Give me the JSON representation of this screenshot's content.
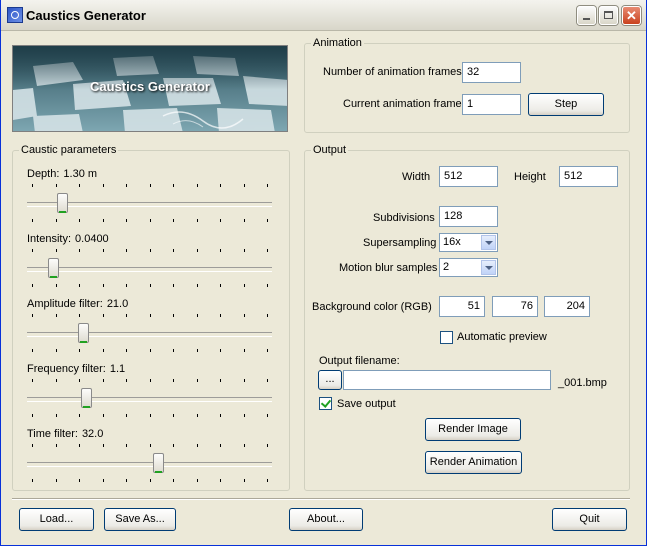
{
  "window": {
    "title": "Caustics Generator"
  },
  "banner": {
    "text": "Caustics Generator"
  },
  "animation": {
    "legend": "Animation",
    "frames_label": "Number of animation frames",
    "frames_value": "32",
    "current_label": "Current animation frame",
    "current_value": "1",
    "step_label": "Step"
  },
  "caustic": {
    "legend": "Caustic parameters",
    "sliders": [
      {
        "label": "Depth:",
        "value": "1.30 m",
        "level": 0.13
      },
      {
        "label": "Intensity:",
        "value": "0.0400",
        "level": 0.09
      },
      {
        "label": "Amplitude filter:",
        "value": "21.0",
        "level": 0.22
      },
      {
        "label": "Frequency filter:",
        "value": "1.1",
        "level": 0.23
      },
      {
        "label": "Time filter:",
        "value": "32.0",
        "level": 0.54
      }
    ]
  },
  "output": {
    "legend": "Output",
    "width_label": "Width",
    "width_value": "512",
    "height_label": "Height",
    "height_value": "512",
    "subdivisions_label": "Subdivisions",
    "subdivisions_value": "128",
    "supersampling_label": "Supersampling",
    "supersampling_value": "16x",
    "motionblur_label": "Motion blur samples",
    "motionblur_value": "2",
    "bg_label": "Background color (RGB)",
    "bg_r": "51",
    "bg_g": "76",
    "bg_b": "204",
    "auto_preview_label": "Automatic preview",
    "auto_preview_checked": false,
    "filename_label": "Output filename:",
    "browse_label": "...",
    "filename_value": "",
    "filename_suffix": "_001.bmp",
    "save_output_label": "Save output",
    "save_output_checked": true,
    "render_image_label": "Render Image",
    "render_animation_label": "Render Animation"
  },
  "footer": {
    "load_label": "Load...",
    "saveas_label": "Save As...",
    "about_label": "About...",
    "quit_label": "Quit"
  }
}
